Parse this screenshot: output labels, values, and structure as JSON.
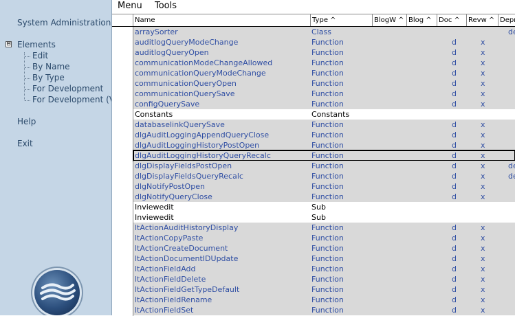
{
  "sidebar": {
    "system_admin": "System Administration",
    "elements": "Elements",
    "tree_toggle": "⊟",
    "tree_items": [
      "Edit",
      "By Name",
      "By Type",
      "For Development",
      "For Development (Ve"
    ],
    "help": "Help",
    "exit": "Exit"
  },
  "menubar": {
    "menu": "Menu",
    "tools": "Tools"
  },
  "columns": [
    "Name",
    "Type ^",
    "BlogW ^",
    "Blog ^",
    "Doc ^",
    "Revw ^",
    "Depr"
  ],
  "rows": [
    {
      "name": "arraySorter",
      "type": "Class",
      "doc": "",
      "rev": "",
      "dep": "de",
      "shade": true
    },
    {
      "name": "auditlogQueryModeChange",
      "type": "Function",
      "doc": "d",
      "rev": "x",
      "dep": "",
      "shade": true
    },
    {
      "name": "auditlogQueryOpen",
      "type": "Function",
      "doc": "d",
      "rev": "x",
      "dep": "",
      "shade": true
    },
    {
      "name": "communicationModeChangeAllowed",
      "type": "Function",
      "doc": "d",
      "rev": "x",
      "dep": "",
      "shade": true
    },
    {
      "name": "communicationQueryModeChange",
      "type": "Function",
      "doc": "d",
      "rev": "x",
      "dep": "",
      "shade": true
    },
    {
      "name": "communicationQueryOpen",
      "type": "Function",
      "doc": "d",
      "rev": "x",
      "dep": "",
      "shade": true
    },
    {
      "name": "communicationQuerySave",
      "type": "Function",
      "doc": "d",
      "rev": "x",
      "dep": "",
      "shade": true
    },
    {
      "name": "configQuerySave",
      "type": "Function",
      "doc": "d",
      "rev": "x",
      "dep": "",
      "shade": true
    },
    {
      "name": "Constants",
      "type": "Constants",
      "doc": "",
      "rev": "",
      "dep": "",
      "shade": false,
      "plain": true
    },
    {
      "name": "databaselinkQuerySave",
      "type": "Function",
      "doc": "d",
      "rev": "x",
      "dep": "",
      "shade": true
    },
    {
      "name": "dlgAuditLoggingAppendQueryClose",
      "type": "Function",
      "doc": "d",
      "rev": "x",
      "dep": "",
      "shade": true
    },
    {
      "name": "dlgAuditLoggingHistoryPostOpen",
      "type": "Function",
      "doc": "d",
      "rev": "x",
      "dep": "",
      "shade": true
    },
    {
      "name": "dlgAuditLoggingHistoryQueryRecalc",
      "type": "Function",
      "doc": "d",
      "rev": "x",
      "dep": "",
      "shade": true,
      "selected": true
    },
    {
      "name": "dlgDisplayFieldsPostOpen",
      "type": "Function",
      "doc": "d",
      "rev": "x",
      "dep": "de",
      "shade": true
    },
    {
      "name": "dlgDisplayFieldsQueryRecalc",
      "type": "Function",
      "doc": "d",
      "rev": "x",
      "dep": "de",
      "shade": true
    },
    {
      "name": "dlgNotifyPostOpen",
      "type": "Function",
      "doc": "d",
      "rev": "x",
      "dep": "",
      "shade": true
    },
    {
      "name": "dlgNotifyQueryClose",
      "type": "Function",
      "doc": "d",
      "rev": "x",
      "dep": "",
      "shade": true
    },
    {
      "name": "Inviewedit",
      "type": "Sub",
      "doc": "",
      "rev": "",
      "dep": "",
      "shade": false,
      "plain": true
    },
    {
      "name": "Inviewedit",
      "type": "Sub",
      "doc": "",
      "rev": "",
      "dep": "",
      "shade": false,
      "plain": true
    },
    {
      "name": "ltActionAuditHistoryDisplay",
      "type": "Function",
      "doc": "d",
      "rev": "x",
      "dep": "",
      "shade": true
    },
    {
      "name": "ltActionCopyPaste",
      "type": "Function",
      "doc": "d",
      "rev": "x",
      "dep": "",
      "shade": true
    },
    {
      "name": "ltActionCreateDocument",
      "type": "Function",
      "doc": "d",
      "rev": "x",
      "dep": "",
      "shade": true
    },
    {
      "name": "ltActionDocumentIDUpdate",
      "type": "Function",
      "doc": "d",
      "rev": "x",
      "dep": "",
      "shade": true
    },
    {
      "name": "ltActionFieldAdd",
      "type": "Function",
      "doc": "d",
      "rev": "x",
      "dep": "",
      "shade": true
    },
    {
      "name": "ltActionFieldDelete",
      "type": "Function",
      "doc": "d",
      "rev": "x",
      "dep": "",
      "shade": true
    },
    {
      "name": "ltActionFieldGetTypeDefault",
      "type": "Function",
      "doc": "d",
      "rev": "x",
      "dep": "",
      "shade": true
    },
    {
      "name": "ltActionFieldRename",
      "type": "Function",
      "doc": "d",
      "rev": "x",
      "dep": "",
      "shade": true
    },
    {
      "name": "ltActionFieldSet",
      "type": "Function",
      "doc": "d",
      "rev": "x",
      "dep": "",
      "shade": true
    }
  ]
}
